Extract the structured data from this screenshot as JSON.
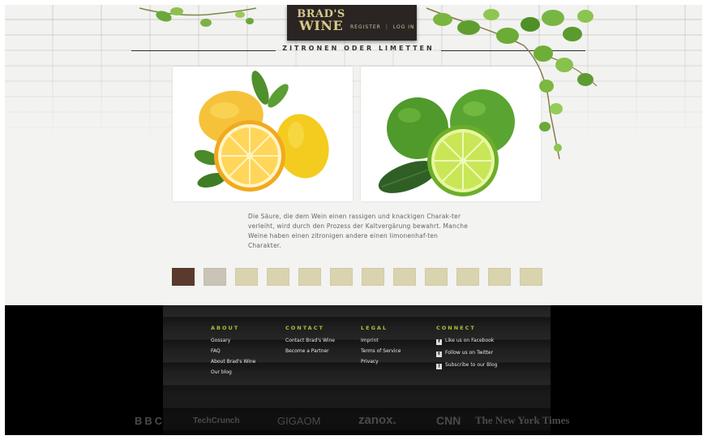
{
  "header": {
    "logo_line1": "BRAD'S",
    "logo_line2": "WINE",
    "register_link": "REGISTER",
    "separator": "|",
    "login_link": "LOG IN"
  },
  "page": {
    "title": "ZITRONEN ODER LIMETTEN",
    "description": "Die Säure, die dem Wein einen rassigen und knackigen Charak-ter verleiht, wird durch den Prozess der Kaltvergärung bewahrt. Manche Weine haben einen zitronigen andere einen limonenhaf-ten Charakter."
  },
  "images": {
    "left": "lemons-photo",
    "right": "limes-photo"
  },
  "thumbnails": [
    {
      "name": "thumb-1",
      "type": "dark"
    },
    {
      "name": "thumb-2",
      "type": "cheese"
    },
    {
      "name": "thumb-3",
      "type": "plain"
    },
    {
      "name": "thumb-4",
      "type": "plain"
    },
    {
      "name": "thumb-5",
      "type": "plain"
    },
    {
      "name": "thumb-6",
      "type": "plain"
    },
    {
      "name": "thumb-7",
      "type": "plain"
    },
    {
      "name": "thumb-8",
      "type": "plain"
    },
    {
      "name": "thumb-9",
      "type": "plain"
    },
    {
      "name": "thumb-10",
      "type": "plain"
    },
    {
      "name": "thumb-11",
      "type": "plain"
    },
    {
      "name": "thumb-12",
      "type": "plain"
    }
  ],
  "footer": {
    "about": {
      "heading": "ABOUT",
      "items": [
        "Gossary",
        "FAQ",
        "About Brad's Wine",
        "Our blog"
      ]
    },
    "contact": {
      "heading": "CONTACT",
      "items": [
        "Contact Brad's Wine",
        "Become a Partner"
      ]
    },
    "legal": {
      "heading": "LEGAL",
      "items": [
        "Imprint",
        "Terms of Service",
        "Privacy"
      ]
    },
    "connect": {
      "heading": "CONNECT",
      "items": [
        "Like us on Facebook",
        "Follow us on Twitter",
        "Subscribe to our Blog"
      ],
      "icons": [
        "facebook-icon",
        "twitter-icon",
        "rss-icon"
      ]
    }
  },
  "press": [
    "BBC",
    "TechCrunch",
    "GIGAOM",
    "zanox.",
    "CNN",
    "The New York Times"
  ],
  "colors": {
    "accent_green": "#a7c13a",
    "logo_gold": "#d8c98a",
    "footer_bg": "#000000",
    "thumb_beige": "#d9d4ae"
  }
}
